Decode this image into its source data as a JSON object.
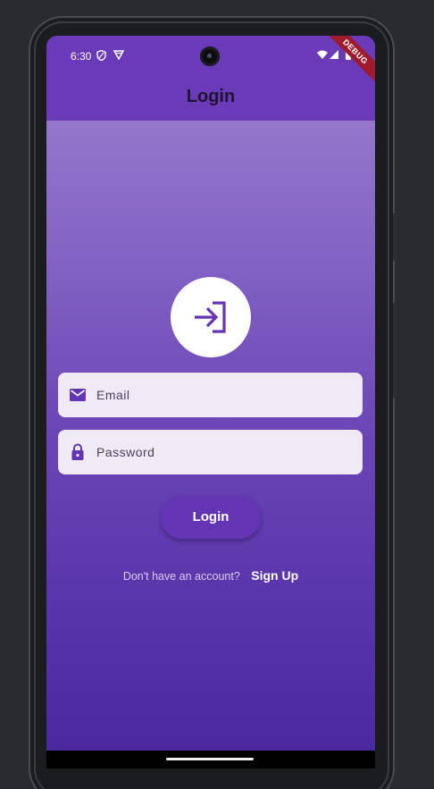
{
  "status_bar": {
    "time": "6:30",
    "debug_label": "DEBUG"
  },
  "app_bar": {
    "title": "Login"
  },
  "form": {
    "email_placeholder": "Email",
    "email_value": "",
    "password_placeholder": "Password",
    "password_value": "",
    "login_button_label": "Login",
    "signup_prompt": "Don't have an account?",
    "signup_link": "Sign Up"
  },
  "colors": {
    "app_bar": "#6a3ab8",
    "accent": "#6335b4",
    "field_bg": "#efeaf6",
    "debug_ribbon": "#a01a2d"
  },
  "icons": {
    "hero": "login-arrow-icon",
    "email": "mail-icon",
    "password": "lock-icon"
  }
}
